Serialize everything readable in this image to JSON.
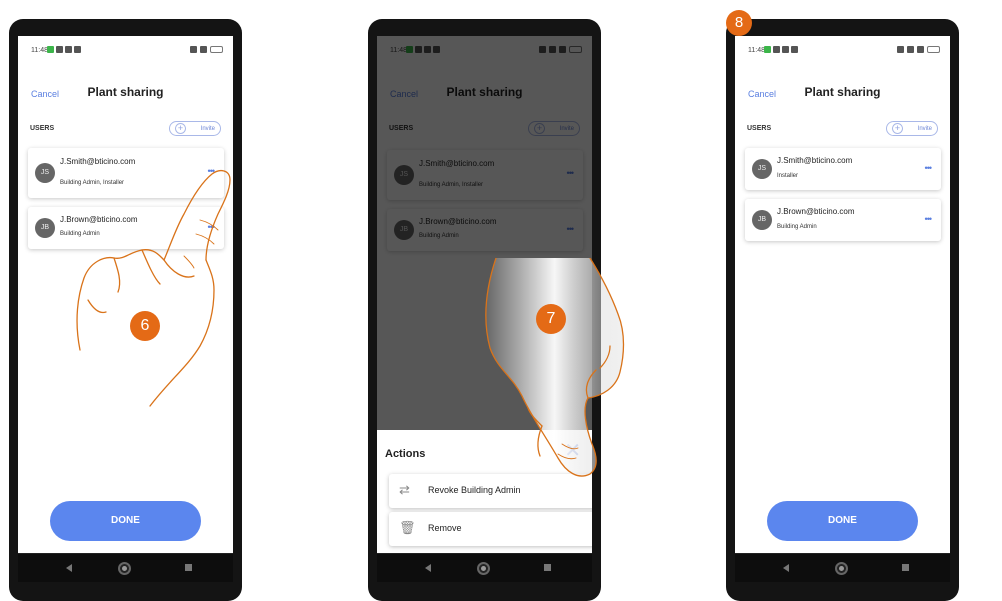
{
  "status": {
    "time": "11:48"
  },
  "screen": {
    "cancel": "Cancel",
    "title": "Plant sharing",
    "users_label": "USERS",
    "invite": "Invite",
    "more": "•••",
    "done": "DONE"
  },
  "users_before": [
    {
      "initials": "JS",
      "email": "J.Smith@bticino.com",
      "role": "Building Admin, Installer"
    },
    {
      "initials": "JB",
      "email": "J.Brown@bticino.com",
      "role": "Building Admin"
    }
  ],
  "users_after": [
    {
      "initials": "JS",
      "email": "J.Smith@bticino.com",
      "role": "Installer"
    },
    {
      "initials": "JB",
      "email": "J.Brown@bticino.com",
      "role": "Building Admin"
    }
  ],
  "actions": {
    "title": "Actions",
    "close": "✕",
    "items": [
      {
        "label": "Revoke Building Admin",
        "icon": "swap-arrows-icon",
        "glyph": "⇄",
        "chevron": "›"
      },
      {
        "label": "Remove",
        "icon": "trash-icon",
        "glyph": "🗑",
        "chevron": "›"
      }
    ]
  },
  "steps": {
    "s6": "6",
    "s7": "7",
    "s8": "8"
  },
  "colors": {
    "accent": "#5b86ee",
    "step": "#e46a16",
    "hand": "#d9731a"
  }
}
